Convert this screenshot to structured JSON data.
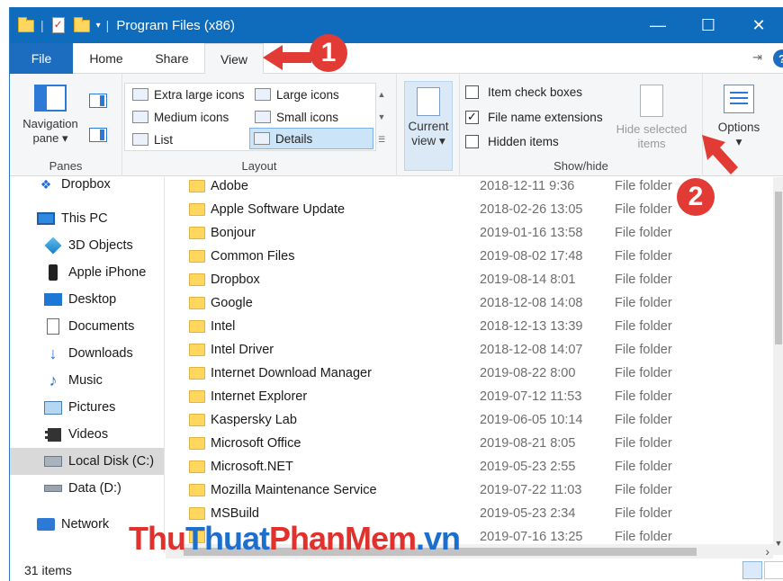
{
  "window": {
    "title": "Program Files (x86)"
  },
  "tabs": {
    "file": "File",
    "home": "Home",
    "share": "Share",
    "view": "View"
  },
  "ribbon": {
    "panes": {
      "label": "Panes",
      "nav_pane": "Navigation",
      "nav_pane_2": "pane"
    },
    "layout": {
      "label": "Layout",
      "items": [
        "Extra large icons",
        "Large icons",
        "Medium icons",
        "Small icons",
        "List",
        "Details"
      ],
      "selected": "Details"
    },
    "current_view": {
      "line1": "Current",
      "line2": "view"
    },
    "show_hide": {
      "label": "Show/hide",
      "item_check_boxes": "Item check boxes",
      "file_name_extensions": "File name extensions",
      "hidden_items": "Hidden items",
      "hide_selected_1": "Hide selected",
      "hide_selected_2": "items"
    },
    "options": {
      "label": "Options"
    }
  },
  "nav": {
    "items": [
      {
        "label": "Dropbox",
        "icon": "dropbox-icon"
      },
      {
        "label": "This PC",
        "icon": "computer-icon"
      },
      {
        "label": "3D Objects",
        "icon": "cube-icon"
      },
      {
        "label": "Apple iPhone",
        "icon": "phone-icon"
      },
      {
        "label": "Desktop",
        "icon": "desktop-icon"
      },
      {
        "label": "Documents",
        "icon": "document-icon"
      },
      {
        "label": "Downloads",
        "icon": "download-icon"
      },
      {
        "label": "Music",
        "icon": "music-icon"
      },
      {
        "label": "Pictures",
        "icon": "pictures-icon"
      },
      {
        "label": "Videos",
        "icon": "video-icon"
      },
      {
        "label": "Local Disk (C:)",
        "icon": "disk-icon"
      },
      {
        "label": "Data (D:)",
        "icon": "drive-icon"
      },
      {
        "label": "Network",
        "icon": "network-icon"
      }
    ]
  },
  "files": [
    {
      "name": "Adobe",
      "date": "2018-12-11 9:36",
      "type": "File folder"
    },
    {
      "name": "Apple Software Update",
      "date": "2018-02-26 13:05",
      "type": "File folder"
    },
    {
      "name": "Bonjour",
      "date": "2019-01-16 13:58",
      "type": "File folder"
    },
    {
      "name": "Common Files",
      "date": "2019-08-02 17:48",
      "type": "File folder"
    },
    {
      "name": "Dropbox",
      "date": "2019-08-14 8:01",
      "type": "File folder"
    },
    {
      "name": "Google",
      "date": "2018-12-08 14:08",
      "type": "File folder"
    },
    {
      "name": "Intel",
      "date": "2018-12-13 13:39",
      "type": "File folder"
    },
    {
      "name": "Intel Driver",
      "date": "2018-12-08 14:07",
      "type": "File folder"
    },
    {
      "name": "Internet Download Manager",
      "date": "2019-08-22 8:00",
      "type": "File folder"
    },
    {
      "name": "Internet Explorer",
      "date": "2019-07-12 11:53",
      "type": "File folder"
    },
    {
      "name": "Kaspersky Lab",
      "date": "2019-06-05 10:14",
      "type": "File folder"
    },
    {
      "name": "Microsoft Office",
      "date": "2019-08-21 8:05",
      "type": "File folder"
    },
    {
      "name": "Microsoft.NET",
      "date": "2019-05-23 2:55",
      "type": "File folder"
    },
    {
      "name": "Mozilla Maintenance Service",
      "date": "2019-07-22 11:03",
      "type": "File folder"
    },
    {
      "name": "MSBuild",
      "date": "2019-05-23 2:34",
      "type": "File folder"
    },
    {
      "name": "",
      "date": "2019-07-16 13:25",
      "type": "File folder"
    }
  ],
  "status": {
    "count": "31 items"
  },
  "annotations": {
    "step1": "1",
    "step2": "2",
    "color": "#e23b36"
  },
  "watermark": {
    "part1": "Thu",
    "part2": "Thuat",
    "part3": "PhanMem",
    "part4": ".vn"
  },
  "colors": {
    "accent": "#0f6cbd",
    "folder": "#ffd75e"
  }
}
